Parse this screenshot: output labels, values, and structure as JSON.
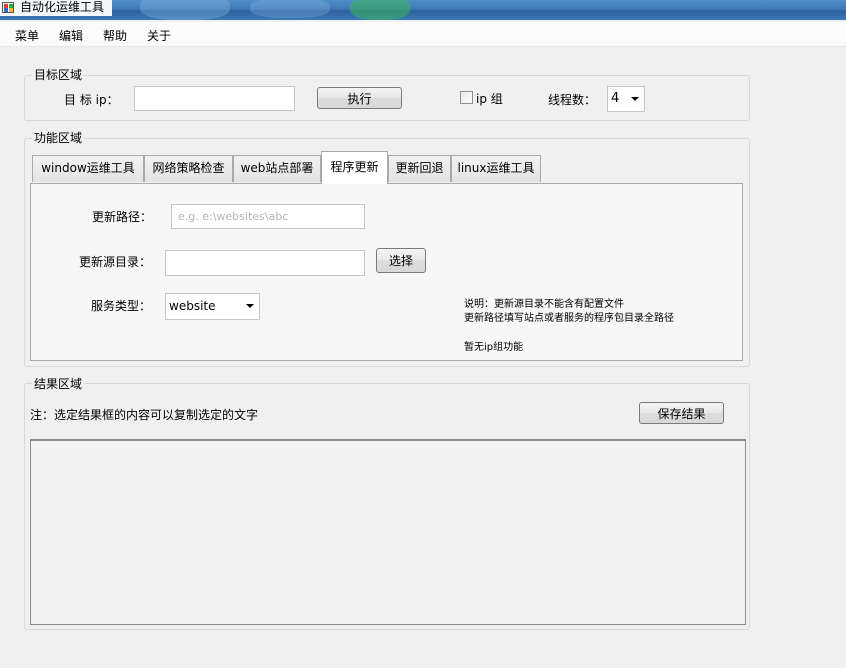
{
  "window": {
    "title": "自动化运维工具"
  },
  "menu": [
    "菜单",
    "编辑",
    "帮助",
    "关于"
  ],
  "target": {
    "group_title": "目标区域",
    "ip_label": "目 标 ip：",
    "ip_value": "",
    "execute_label": "执行",
    "ip_group_label": "ip 组",
    "ip_group_checked": false,
    "threads_label": "线程数：",
    "threads_value": "4"
  },
  "function": {
    "group_title": "功能区域",
    "tabs": [
      {
        "label": "window运维工具",
        "active": false
      },
      {
        "label": "网络策略检查",
        "active": false
      },
      {
        "label": "web站点部署",
        "active": false
      },
      {
        "label": "程序更新",
        "active": true
      },
      {
        "label": "更新回退",
        "active": false
      },
      {
        "label": "linux运维工具",
        "active": false
      }
    ],
    "update_path_label": "更新路径：",
    "update_path_placeholder": "e.g. e:\\websites\\abc",
    "source_dir_label": "更新源目录：",
    "source_dir_value": "",
    "select_label": "选择",
    "service_type_label": "服务类型：",
    "service_type_value": "website",
    "notes": [
      "说明：更新源目录不能含有配置文件",
      "更新路径填写站点或者服务的程序包目录全路径",
      "暂无ip组功能"
    ]
  },
  "result": {
    "group_title": "结果区域",
    "note": "注：选定结果框的内容可以复制选定的文字",
    "save_label": "保存结果",
    "content": ""
  }
}
